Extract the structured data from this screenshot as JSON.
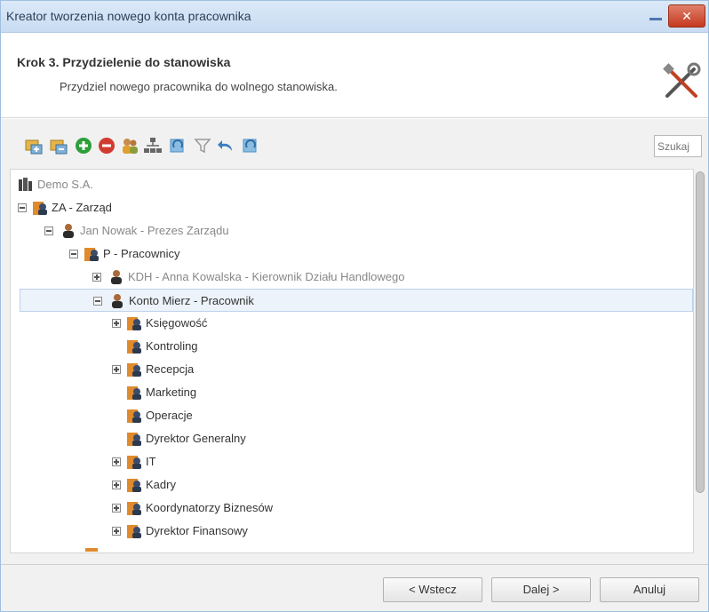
{
  "window": {
    "title": "Kreator tworzenia nowego konta pracownika",
    "close_glyph": "✕"
  },
  "header": {
    "step_title": "Krok 3. Przydzielenie do stanowiska",
    "step_description": "Przydziel nowego pracownika do wolnego stanowiska.",
    "icon": "tools-icon"
  },
  "toolbar": {
    "icons": [
      "expand-all-icon",
      "collapse-all-icon",
      "add-icon",
      "remove-icon",
      "users-icon",
      "org-chart-icon",
      "refresh-icon",
      "filter-icon",
      "undo-icon",
      "refresh-alt-icon"
    ],
    "search_placeholder": "Szukaj"
  },
  "tree": {
    "nodes": [
      {
        "label": "Demo S.A.",
        "type": "company",
        "expander": "none",
        "muted": true
      },
      {
        "label": "ZA - Zarząd",
        "type": "department",
        "expander": "minus",
        "muted": false
      },
      {
        "label": "Jan Nowak - Prezes Zarządu",
        "type": "person",
        "expander": "minus",
        "muted": true
      },
      {
        "label": "P - Pracownicy",
        "type": "department",
        "expander": "minus",
        "muted": false
      },
      {
        "label": "KDH - Anna Kowalska - Kierownik Działu Handlowego",
        "type": "person",
        "expander": "plus",
        "muted": true
      },
      {
        "label": "Konto Mierz - Pracownik",
        "type": "person",
        "expander": "minus",
        "muted": false,
        "selected": true
      },
      {
        "label": "Księgowość",
        "type": "department",
        "expander": "plus",
        "muted": false
      },
      {
        "label": "Kontroling",
        "type": "department",
        "expander": "none",
        "muted": false
      },
      {
        "label": "Recepcja",
        "type": "department",
        "expander": "plus",
        "muted": false
      },
      {
        "label": "Marketing",
        "type": "department",
        "expander": "none",
        "muted": false
      },
      {
        "label": "Operacje",
        "type": "department",
        "expander": "none",
        "muted": false
      },
      {
        "label": "Dyrektor Generalny",
        "type": "department",
        "expander": "none",
        "muted": false
      },
      {
        "label": "IT",
        "type": "department",
        "expander": "plus",
        "muted": false
      },
      {
        "label": "Kadry",
        "type": "department",
        "expander": "plus",
        "muted": false
      },
      {
        "label": "Koordynatorzy Biznesów",
        "type": "department",
        "expander": "plus",
        "muted": false
      },
      {
        "label": "Dyrektor Finansowy",
        "type": "department",
        "expander": "plus",
        "muted": false
      }
    ]
  },
  "footer": {
    "back_label": "< Wstecz",
    "next_label": "Dalej >",
    "cancel_label": "Anuluj"
  },
  "colors": {
    "titlebar": "#c9dcf2",
    "close_button": "#c4391f",
    "selection": "#edf3fa",
    "department_icon": "#e08a2e",
    "add_green": "#2e9e3a",
    "remove_red": "#d23b2f",
    "refresh_blue": "#4a90c8"
  }
}
